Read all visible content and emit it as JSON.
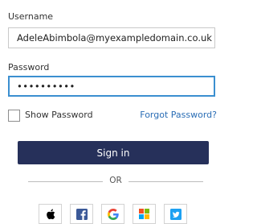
{
  "form": {
    "username_label": "Username",
    "username_value": "AdeleAbimbola@myexampledomain.co.uk",
    "password_label": "Password",
    "password_value": "••••••••••",
    "show_password_label": "Show Password",
    "show_password_checked": false,
    "forgot_password_label": "Forgot Password?",
    "sign_in_label": "Sign in",
    "divider_label": "OR"
  },
  "social": [
    {
      "icon": "apple-icon",
      "color": "#000000"
    },
    {
      "icon": "facebook-icon",
      "color": "#3b5998"
    },
    {
      "icon": "google-icon",
      "color": "#4285f4"
    },
    {
      "icon": "microsoft-icon",
      "color": "#f25022"
    },
    {
      "icon": "twitter-icon",
      "color": "#1da1f2"
    }
  ],
  "colors": {
    "primary_button": "#26305a",
    "link": "#2a6db5",
    "focus_border": "#3b8fd0"
  }
}
